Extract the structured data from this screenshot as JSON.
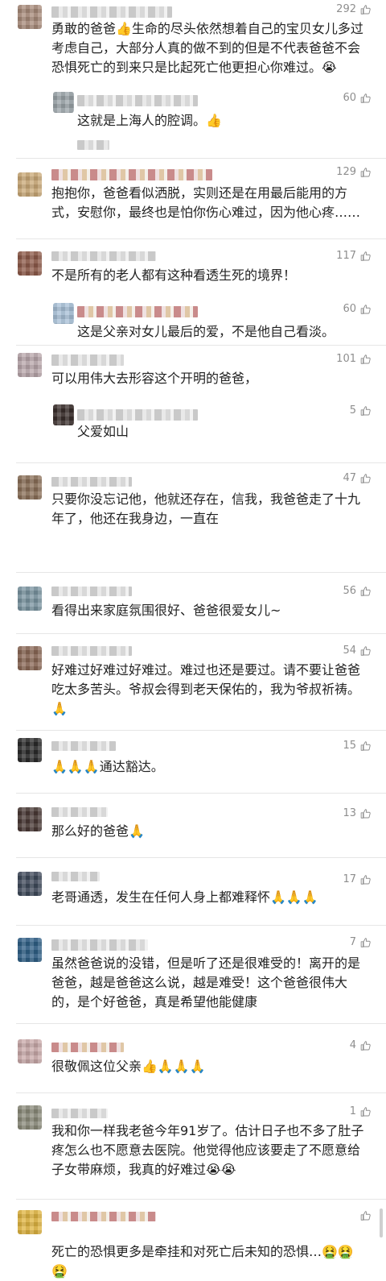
{
  "comments": [
    {
      "likes": "292",
      "text": "勇敢的爸爸👍生命的尽头依然想着自己的宝贝女儿多过考虑自己，大部分人真的做不到的但是不代表爸爸不会恐惧死亡的到来只是比起死亡他更担心你难过。😭"
    },
    {
      "likes": "60",
      "text": "这就是上海人的腔调。👍"
    },
    {
      "likes": "129",
      "text": "抱抱你，爸爸看似洒脱，实则还是在用最后能用的方式，安慰你，最终也是怕你伤心难过，因为他心疼……"
    },
    {
      "likes": "117",
      "text": "不是所有的老人都有这种看透生死的境界！"
    },
    {
      "likes": "60",
      "text": "这是父亲对女儿最后的爱，不是他自己看淡。"
    },
    {
      "likes": "101",
      "text": "可以用伟大去形容这个开明的爸爸，"
    },
    {
      "likes": "5",
      "text": "父爱如山"
    },
    {
      "likes": "47",
      "text": "只要你没忘记他，他就还存在，信我，我爸爸走了十九年了，他还在我身边，一直在"
    },
    {
      "likes": "56",
      "text": "看得出来家庭氛围很好、爸爸很爱女儿~"
    },
    {
      "likes": "54",
      "text": "好难过好难过好难过。难过也还是要过。请不要让爸爸吃太多苦头。爷叔会得到老天保佑的，我为爷叔祈祷。🙏"
    },
    {
      "likes": "15",
      "text": "🙏🙏🙏通达豁达。"
    },
    {
      "likes": "13",
      "text": "那么好的爸爸🙏"
    },
    {
      "likes": "17",
      "text": "老哥通透，发生在任何人身上都难释怀🙏🙏🙏"
    },
    {
      "likes": "7",
      "text": "虽然爸爸说的没错，但是听了还是很难受的！离开的是爸爸，越是爸爸这么说，越是难受！这个爸爸很伟大的，是个好爸爸，真是希望他能健康"
    },
    {
      "likes": "4",
      "text": "很敬佩这位父亲👍🙏🙏🙏"
    },
    {
      "likes": "1",
      "text": "我和你一样我老爸今年91岁了。估计日子也不多了肚子疼怎么也不愿意去医院。他觉得他应该要走了不愿意给子女带麻烦，我真的好难过😭😭"
    },
    {
      "likes": "",
      "text": "死亡的恐惧更多是牵挂和对死亡后未知的恐惧…🤮🤮🤮"
    }
  ],
  "icons": {
    "like": "thumbs-up-icon",
    "avatar": "avatar"
  },
  "colors": {
    "text": "#222222",
    "meta": "#8e8e8e",
    "divider": "#e6e6e6"
  }
}
